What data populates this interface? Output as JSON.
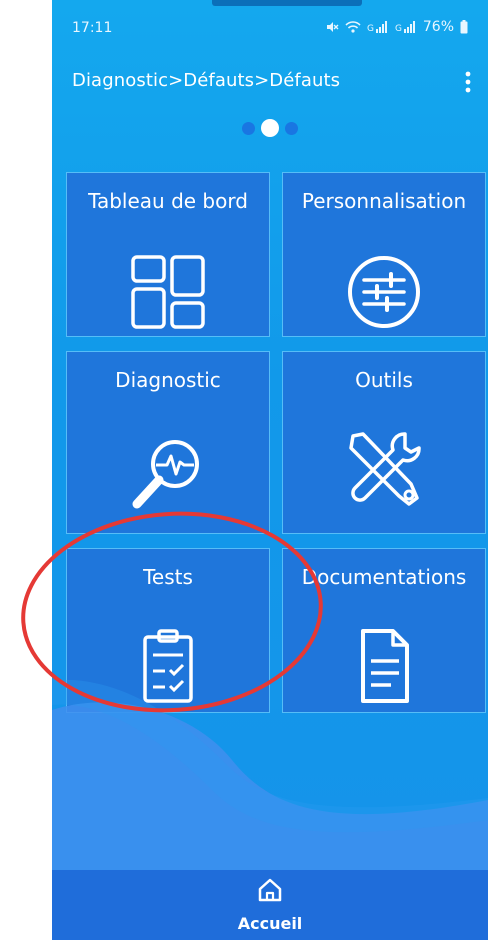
{
  "status_bar": {
    "time": "17:11",
    "battery": "76%"
  },
  "header": {
    "breadcrumb": "Diagnostic>Défauts>Défauts"
  },
  "pager": {
    "page_count": 3,
    "active_page": 2
  },
  "tiles": [
    {
      "label": "Tableau de bord",
      "icon": "dashboard-icon"
    },
    {
      "label": "Personnalisation",
      "icon": "sliders-icon"
    },
    {
      "label": "Diagnostic",
      "icon": "diagnostic-magnifier-icon"
    },
    {
      "label": "Outils",
      "icon": "tools-icon"
    },
    {
      "label": "Tests",
      "icon": "clipboard-check-icon"
    },
    {
      "label": "Documentations",
      "icon": "document-icon"
    }
  ],
  "bottom_nav": {
    "home_label": "Accueil",
    "home_icon": "home-icon"
  },
  "colors": {
    "background": "#14a8ee",
    "tile": "#1f76db",
    "tile_border": "#56bdf7",
    "nav": "#1f6dda",
    "annotation": "#e53935"
  }
}
